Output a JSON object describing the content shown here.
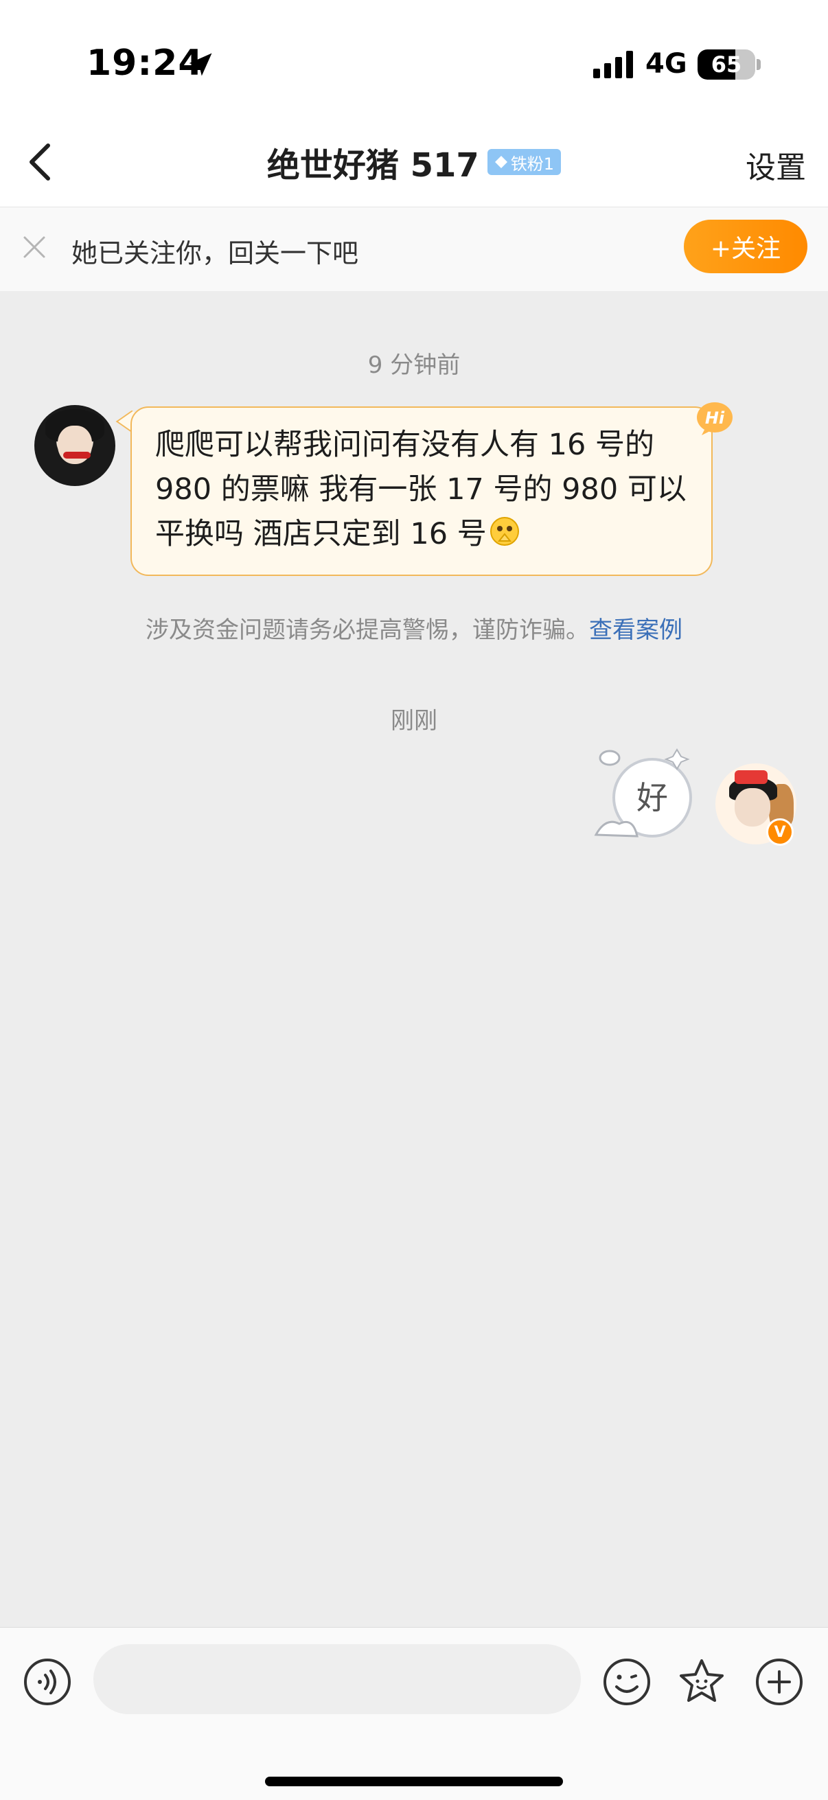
{
  "status_bar": {
    "time": "19:24",
    "network": "4G",
    "battery": "65",
    "battery_level": 0.65
  },
  "nav": {
    "title": "绝世好猪 517",
    "badge": "铁粉1",
    "settings": "设置"
  },
  "follow_banner": {
    "text": "她已关注你，回关一下吧",
    "button": "+关注"
  },
  "chat": {
    "timestamp_1": "9 分钟前",
    "message_1": "爬爬可以帮我问问有没有人有 16 号的 980 的票嘛 我有一张 17 号的 980 可以平换吗 酒店只定到 16 号",
    "warning_text": "涉及资金问题请务必提高警惕，谨防诈骗。",
    "warning_link": "查看案例",
    "timestamp_2": "刚刚",
    "sticker_text": "好",
    "right_avatar_badge": "V"
  },
  "input_bar": {
    "placeholder": ""
  },
  "colors": {
    "accent_orange": "#ff8a00",
    "bubble_border": "#f2b85a",
    "link_blue": "#3a6fb8",
    "fan_badge": "#8ec5f5"
  },
  "icons": [
    "location-arrow-icon",
    "signal-icon",
    "battery-icon",
    "back-chevron-icon",
    "diamond-icon",
    "close-icon",
    "hi-icon",
    "pray-emoji-icon",
    "voice-icon",
    "emoji-icon",
    "star-icon",
    "plus-icon"
  ]
}
